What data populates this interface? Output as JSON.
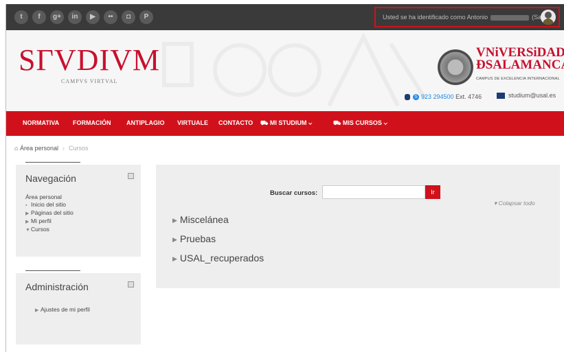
{
  "topbar": {
    "social_icons": [
      "twitter-icon",
      "facebook-icon",
      "google-plus-icon",
      "linkedin-icon",
      "youtube-icon",
      "flickr-icon",
      "instagram-icon",
      "pinterest-icon"
    ],
    "social_glyphs": [
      "t",
      "f",
      "g+",
      "in",
      "▶",
      "••",
      "◘",
      "P"
    ],
    "login_prefix": "Usted se ha identificado como Antonio",
    "logout_label": "(Salir)"
  },
  "header": {
    "brand": "SΓVDIVM",
    "brand_sub": "CAMPVS VIRTVAL",
    "usal_line1": "VNiVERSiDAD",
    "usal_line2": "ÐSALAMANCA",
    "usal_tag": "CAMPUS DE EXCELENCIA INTERNACIONAL",
    "phone": "923 294500",
    "ext": "Ext. 4746",
    "email": "studium@usal.es"
  },
  "nav": {
    "items": [
      {
        "label": "NORMATIVA"
      },
      {
        "label": "FORMACIÓN"
      },
      {
        "label": "ANTIPLAGIO"
      },
      {
        "label": "VIRTUALE"
      },
      {
        "label": "CONTACTO"
      },
      {
        "label": "MI STUDIUM ⌄"
      },
      {
        "label": "MIS CURSOS ⌄"
      }
    ]
  },
  "breadcrumb": {
    "home": "Área personal",
    "current": "Cursos"
  },
  "navegacion": {
    "title": "Navegación",
    "items": [
      "Área personal",
      "Inicio del sitio",
      "Páginas del sitio",
      "Mi perfil",
      "Cursos"
    ]
  },
  "administracion": {
    "title": "Administración",
    "items": [
      "Ajustes de mi perfil"
    ]
  },
  "main": {
    "search_label": "Buscar cursos:",
    "search_button": "Ir",
    "collapse_all": "Colapsar todo",
    "categories": [
      "Miscelánea",
      "Pruebas",
      "USAL_recuperados"
    ]
  },
  "colors": {
    "accent_red": "#d0111b",
    "topbar": "#3a3a3a",
    "panel": "#eeeeee"
  }
}
